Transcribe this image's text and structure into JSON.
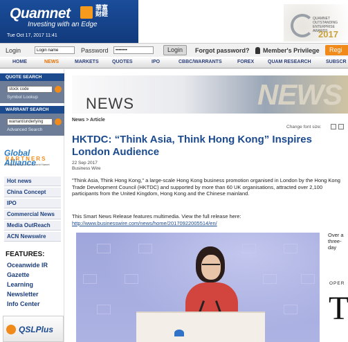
{
  "header": {
    "logo_text": "Quamnet",
    "logo_cn": "華富財經",
    "tagline": "Investing with an Edge",
    "datetime": "Tue Oct 17, 2017 11:41",
    "award_text": "QUAMNET OUTSTANDING ENTERPRISE AWARDS",
    "award_year": "2017"
  },
  "login": {
    "login_label": "Login",
    "login_placeholder": "Login name",
    "password_label": "Password",
    "password_value": "••••••••",
    "login_button": "Login",
    "forgot_link": "Forgot password?",
    "member_link": "Member's Privilege",
    "register_button": "Regi"
  },
  "nav": {
    "items": [
      "HOME",
      "NEWS",
      "MARKETS",
      "QUOTES",
      "IPO",
      "CBBC/WARRANTS",
      "FOREX",
      "QUAM RESEARCH",
      "SUBSCR"
    ]
  },
  "sidebar": {
    "quote_search_head": "QUOTE SEARCH",
    "quote_input": "stock code",
    "symbol_lookup": "Symbol Lookup",
    "warrant_search_head": "WARRANT SEARCH",
    "warrant_input": "warrant/underlying",
    "advanced_search": "Advanced Search",
    "ga_title": "Global Alliance",
    "ga_sub": "PARTNERS",
    "ga_tiny": "Bringing the you to the world Hamet",
    "menu": [
      "Hot news",
      "China Concept",
      "IPO",
      "Commercial News",
      "Media OutReach",
      "ACN Newswire"
    ],
    "features_head": "FEATURES:",
    "features": [
      "Oceanwide IR",
      "Gazette",
      "Learning",
      "Newsletter",
      "Info Center"
    ],
    "qsl_text": "QSLPlus"
  },
  "article": {
    "banner_title": "NEWS",
    "banner_3d": "NEWS",
    "breadcrumb_section": "News",
    "breadcrumb_sep": " > ",
    "breadcrumb_page": "Article",
    "font_size_label": "Change font size:",
    "headline": "HKTDC: “Think Asia, Think Hong Kong” Inspires London Audience",
    "date": "22 Sep 2017",
    "source": "Business Wire",
    "paragraph": "\"Think Asia, Think Hong Kong,\" a large-scale Hong Kong business promotion organised in London by the Hong Kong Trade Development Council (HKTDC) and supported by more than 60 UK organisations, attracted over 2,100 participants from the United Kingdom, Hong Kong and the Chinese mainland.",
    "multimedia_text": "This Smart News Release features multimedia. View the full release here:",
    "url": "http://www.businesswire.com/news/home/20170922005514/en/",
    "side_text": "Over a three-day",
    "oper_text": "OPER",
    "big_letter": "T"
  }
}
